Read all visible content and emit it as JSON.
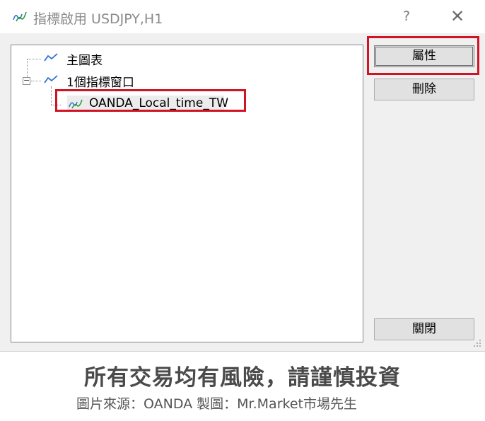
{
  "window": {
    "title": "指標啟用 USDJPY,H1",
    "help_label": "?",
    "close_label": "✕"
  },
  "tree": {
    "items": [
      {
        "label": "主圖表",
        "icon": "line-chart-icon"
      },
      {
        "label": "1個指標窗口",
        "icon": "line-chart-icon",
        "expander": "−"
      },
      {
        "label": "OANDA_Local_time_TW",
        "icon": "indicator-icon",
        "selected": true
      }
    ]
  },
  "buttons": {
    "properties": "屬性",
    "delete": "刪除",
    "close": "關閉"
  },
  "footer": {
    "warning": "所有交易均有風險，請謹慎投資",
    "source": "圖片來源：OANDA 製圖：Mr.Market市場先生"
  },
  "colors": {
    "highlight": "#d01426",
    "indicator_green": "#2a9a3a",
    "indicator_blue": "#2f6fd6"
  }
}
